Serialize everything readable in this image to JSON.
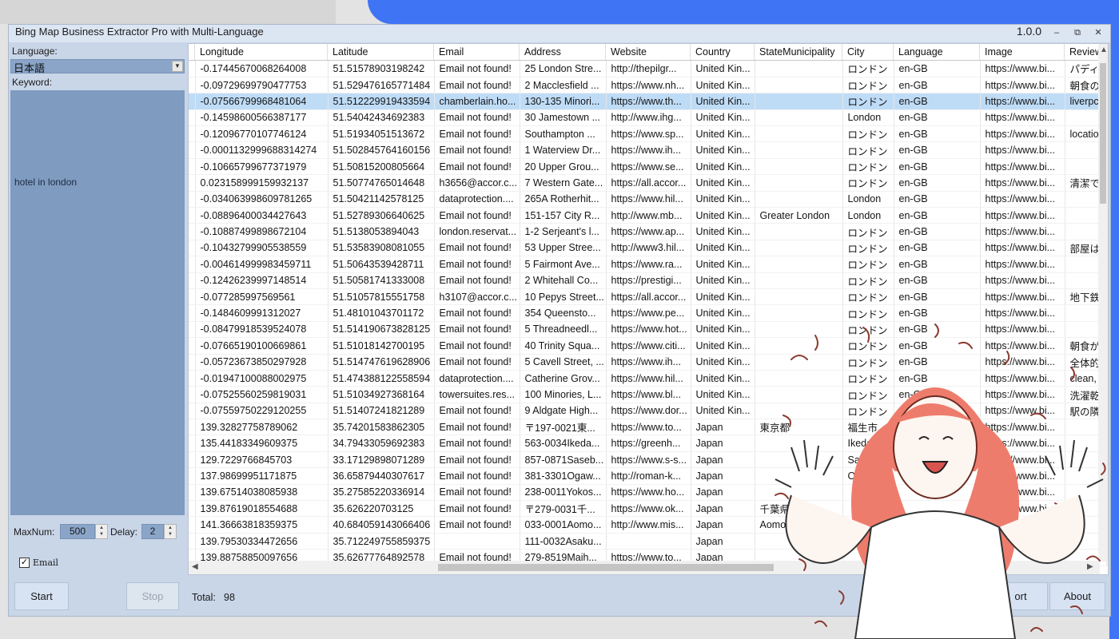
{
  "window": {
    "title": "Bing Map Business Extractor Pro with Multi-Language",
    "version": "1.0.0",
    "controls": [
      "–",
      "⧉",
      "✕"
    ]
  },
  "left_panel": {
    "language_label": "Language:",
    "language_value": "日本語",
    "keyword_label": "Keyword:",
    "keyword_value": "hotel in london",
    "maxnum_label": "MaxNum:",
    "maxnum_value": "500",
    "delay_label": "Delay:",
    "delay_value": "2",
    "email_checkbox_label": "Email",
    "email_checked": true,
    "start_label": "Start",
    "stop_label": "Stop"
  },
  "bottom": {
    "total_label": "Total:",
    "total_value": "98",
    "export_label": "ort",
    "about_label": "About"
  },
  "table": {
    "columns": [
      "Longitude",
      "Latitude",
      "Email",
      "Address",
      "Website",
      "Country",
      "StateMunicipality",
      "City",
      "Language",
      "Image",
      "Review"
    ],
    "selected_row": 2,
    "rows": [
      [
        "-0.17445670068264008",
        "51.51578903198242",
        "Email not found!",
        "25 London Stre...",
        "http://thepilgr...",
        "United Kin...",
        "",
        "ロンドン",
        "en-GB",
        "https://www.bi...",
        "パディ"
      ],
      [
        "-0.09729699790477753",
        "51.529476165771484",
        "Email not found!",
        "2 Macclesfield ...",
        "https://www.nh...",
        "United Kin...",
        "",
        "ロンドン",
        "en-GB",
        "https://www.bi...",
        "朝食の"
      ],
      [
        "-0.07566799968481064",
        "51.512229919433594",
        "chamberlain.ho...",
        "130-135 Minori...",
        "https://www.th...",
        "United Kin...",
        "",
        "ロンドン",
        "en-GB",
        "https://www.bi...",
        "liverpc"
      ],
      [
        "-0.14598600566387177",
        "51.54042434692383",
        "Email not found!",
        "30 Jamestown ...",
        "http://www.ihg...",
        "United Kin...",
        "",
        "London",
        "en-GB",
        "https://www.bi...",
        ""
      ],
      [
        "-0.12096770107746124",
        "51.51934051513672",
        "Email not found!",
        "Southampton ...",
        "https://www.sp...",
        "United Kin...",
        "",
        "ロンドン",
        "en-GB",
        "https://www.bi...",
        "locatio"
      ],
      [
        "-0.0001132999688314274",
        "51.502845764160156",
        "Email not found!",
        "1 Waterview Dr...",
        "https://www.ih...",
        "United Kin...",
        "",
        "ロンドン",
        "en-GB",
        "https://www.bi...",
        ""
      ],
      [
        "-0.10665799677371979",
        "51.50815200805664",
        "Email not found!",
        "20 Upper Grou...",
        "https://www.se...",
        "United Kin...",
        "",
        "ロンドン",
        "en-GB",
        "https://www.bi...",
        ""
      ],
      [
        "0.023158999159932137",
        "51.50774765014648",
        "h3656@accor.c...",
        "7 Western Gate...",
        "https://all.accor...",
        "United Kin...",
        "",
        "ロンドン",
        "en-GB",
        "https://www.bi...",
        "清潔で"
      ],
      [
        "-0.034063998609781265",
        "51.50421142578125",
        "dataprotection....",
        "265A Rotherhit...",
        "https://www.hil...",
        "United Kin...",
        "",
        "London",
        "en-GB",
        "https://www.bi...",
        ""
      ],
      [
        "-0.08896400034427643",
        "51.52789306640625",
        "Email not found!",
        "151-157 City R...",
        "http://www.mb...",
        "United Kin...",
        "Greater London",
        "London",
        "en-GB",
        "https://www.bi...",
        ""
      ],
      [
        "-0.10887499898672104",
        "51.5138053894043",
        "london.reservat...",
        "1-2 Serjeant's l...",
        "https://www.ap...",
        "United Kin...",
        "",
        "ロンドン",
        "en-GB",
        "https://www.bi...",
        ""
      ],
      [
        "-0.10432799905538559",
        "51.53583908081055",
        "Email not found!",
        "53 Upper Stree...",
        "http://www3.hil...",
        "United Kin...",
        "",
        "ロンドン",
        "en-GB",
        "https://www.bi...",
        "部屋は"
      ],
      [
        "-0.004614999983459711",
        "51.50643539428711",
        "Email not found!",
        "5 Fairmont Ave...",
        "https://www.ra...",
        "United Kin...",
        "",
        "ロンドン",
        "en-GB",
        "https://www.bi...",
        ""
      ],
      [
        "-0.12426239997148514",
        "51.50581741333008",
        "Email not found!",
        "2 Whitehall Co...",
        "https://prestigi...",
        "United Kin...",
        "",
        "ロンドン",
        "en-GB",
        "https://www.bi...",
        ""
      ],
      [
        "-0.077285997569561",
        "51.51057815551758",
        "h3107@accor.c...",
        "10 Pepys Street...",
        "https://all.accor...",
        "United Kin...",
        "",
        "ロンドン",
        "en-GB",
        "https://www.bi...",
        "地下鉄"
      ],
      [
        "-0.1484609991312027",
        "51.48101043701172",
        "Email not found!",
        "354 Queensto...",
        "https://www.pe...",
        "United Kin...",
        "",
        "ロンドン",
        "en-GB",
        "https://www.bi...",
        ""
      ],
      [
        "-0.08479918539524078",
        "51.514190673828125",
        "Email not found!",
        "5 Threadneedl...",
        "https://www.hot...",
        "United Kin...",
        "",
        "ロンドン",
        "en-GB",
        "https://www.bi...",
        ""
      ],
      [
        "-0.07665190100669861",
        "51.51018142700195",
        "Email not found!",
        "40 Trinity Squa...",
        "https://www.citi...",
        "United Kin...",
        "",
        "ロンドン",
        "en-GB",
        "https://www.bi...",
        "朝食が"
      ],
      [
        "-0.05723673850297928",
        "51.514747619628906",
        "Email not found!",
        "5 Cavell Street, ...",
        "https://www.ih...",
        "United Kin...",
        "",
        "ロンドン",
        "en-GB",
        "https://www.bi...",
        "全体的"
      ],
      [
        "-0.01947100088002975",
        "51.474388122558594",
        "dataprotection....",
        "Catherine Grov...",
        "https://www.hil...",
        "United Kin...",
        "",
        "ロンドン",
        "en-GB",
        "https://www.bi...",
        "clean,"
      ],
      [
        "-0.07525560259819031",
        "51.51034927368164",
        "towersuites.res...",
        "100 Minories, L...",
        "https://www.bl...",
        "United Kin...",
        "",
        "ロンドン",
        "en-GB",
        "https://www.bi...",
        "洗濯乾"
      ],
      [
        "-0.07559750229120255",
        "51.51407241821289",
        "Email not found!",
        "9 Aldgate High...",
        "https://www.dor...",
        "United Kin...",
        "",
        "ロンドン",
        "en-GB",
        "https://www.bi...",
        "駅の隣"
      ],
      [
        "139.32827758789062",
        "35.74201583862305",
        "Email not found!",
        "〒197-0021東...",
        "https://www.to...",
        "Japan",
        "東京都",
        "福生市",
        "",
        "https://www.bi...",
        ""
      ],
      [
        "135.44183349609375",
        "34.79433059692383",
        "Email not found!",
        "563-0034Ikeda...",
        "https://greenh...",
        "Japan",
        "",
        "Ikeda",
        "",
        "https://www.bi...",
        ""
      ],
      [
        "129.7229766845703",
        "33.17129898071289",
        "Email not found!",
        "857-0871Saseb...",
        "https://www.s-s...",
        "Japan",
        "",
        "Sasebo",
        "",
        "https://www.bi...",
        ""
      ],
      [
        "137.98699951171875",
        "36.65879440307617",
        "Email not found!",
        "381-3301Ogaw...",
        "http://roman-k...",
        "Japan",
        "",
        "Ogawa-",
        "",
        "https://www.bi...",
        ""
      ],
      [
        "139.67514038085938",
        "35.27585220336914",
        "Email not found!",
        "238-0011Yokos...",
        "https://www.ho...",
        "Japan",
        "",
        "",
        "",
        "https://www.bi...",
        ""
      ],
      [
        "139.87619018554688",
        "35.626220703125",
        "Email not found!",
        "〒279-0031千...",
        "https://www.ok...",
        "Japan",
        "千葉県",
        "",
        "",
        "https://www.bi...",
        ""
      ],
      [
        "141.36663818359375",
        "40.684059143066406",
        "Email not found!",
        "033-0001Aomo...",
        "http://www.mis...",
        "Japan",
        "Aomori",
        "",
        "",
        "https://www.bi...",
        ""
      ],
      [
        "139.79530334472656",
        "35.712249755859375",
        "",
        "111-0032Asaku...",
        "",
        "Japan",
        "",
        "",
        "",
        "",
        ""
      ],
      [
        "139.88758850097656",
        "35.62677764892578",
        "Email not found!",
        "279-8519Maih...",
        "https://www.to...",
        "Japan",
        "",
        "",
        "",
        "",
        ""
      ]
    ]
  }
}
